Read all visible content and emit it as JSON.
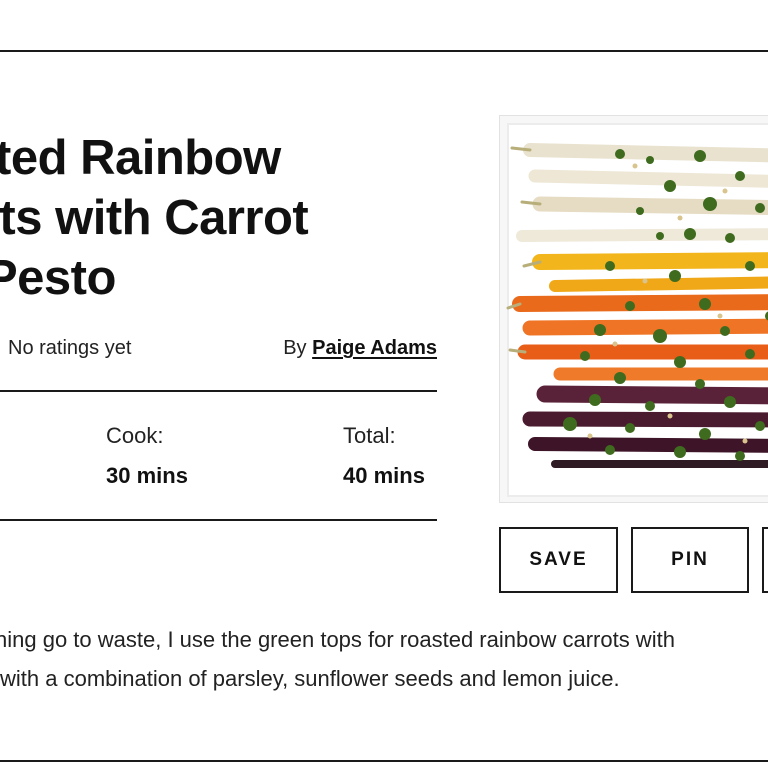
{
  "recipe": {
    "title_lines": [
      "ted Rainbow",
      "ots with Carrot",
      "Pesto"
    ],
    "ratings_text": "No ratings yet",
    "byline_prefix": "By",
    "author": "Paige Adams",
    "times": {
      "cook_label": "Cook:",
      "cook_value": "30 mins",
      "total_label": "Total:",
      "total_value": "40 mins"
    },
    "description_lines": [
      "hing go to waste, I use the green tops for roasted rainbow carrots with",
      "with a combination of parsley, sunflower seeds and lemon juice."
    ]
  },
  "actions": {
    "save_label": "SAVE",
    "pin_label": "PIN"
  },
  "colors": {
    "text": "#111111",
    "rule": "#1a1a1a",
    "background": "#ffffff"
  }
}
